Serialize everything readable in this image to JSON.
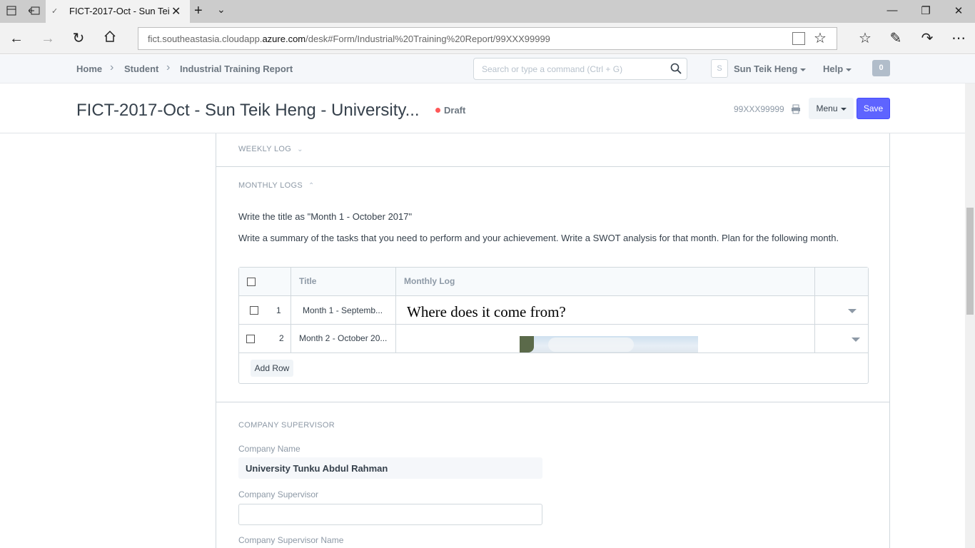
{
  "browser": {
    "tab_title": "FICT-2017-Oct - Sun Tei",
    "url_prefix": "fict.southeastasia.cloudapp.",
    "url_domain": "azure.com",
    "url_suffix": "/desk#Form/Industrial%20Training%20Report/99XXX99999"
  },
  "appbar": {
    "breadcrumbs": [
      "Home",
      "Student",
      "Industrial Training Report"
    ],
    "search_placeholder": "Search or type a command (Ctrl + G)",
    "avatar_letter": "S",
    "user_name": "Sun Teik Heng",
    "help_label": "Help",
    "notification_count": "0"
  },
  "page": {
    "title": "FICT-2017-Oct - Sun Teik Heng - University...",
    "status": "Draft",
    "doc_id": "99XXX99999",
    "menu_label": "Menu",
    "save_label": "Save"
  },
  "form": {
    "weekly_log_heading": "WEEKLY LOG",
    "monthly_logs_heading": "MONTHLY LOGS",
    "instruction_1": "Write the title as \"Month 1 - October 2017\"",
    "instruction_2": "Write a summary of the tasks that you need to perform and your achievement. Write a SWOT analysis for that month. Plan for the following month.",
    "grid": {
      "col_title": "Title",
      "col_log": "Monthly Log",
      "rows": [
        {
          "idx": "1",
          "title": "Month 1 - Septemb...",
          "log": "Where does it come from?"
        },
        {
          "idx": "2",
          "title": "Month 2 - October 20...",
          "log": ""
        }
      ],
      "add_row_label": "Add Row"
    },
    "company_supervisor_heading": "COMPANY SUPERVISOR",
    "company_name_label": "Company Name",
    "company_name_value": "University Tunku Abdul Rahman",
    "company_supervisor_label": "Company Supervisor",
    "company_supervisor_value": "",
    "company_supervisor_name_label": "Company Supervisor Name"
  },
  "colors": {
    "primary": "#5e64ff",
    "draft_dot": "#ff5858",
    "muted_text": "#8d99a6"
  }
}
